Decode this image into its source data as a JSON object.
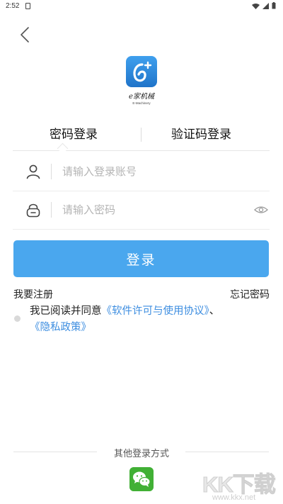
{
  "status_bar": {
    "time": "2:52"
  },
  "app": {
    "logo_text": "e家机械",
    "logo_subtext": "E-Machinery"
  },
  "tabs": [
    {
      "label": "密码登录",
      "active": true
    },
    {
      "label": "验证码登录",
      "active": false
    }
  ],
  "form": {
    "account": {
      "placeholder": "请输入登录账号",
      "value": ""
    },
    "password": {
      "placeholder": "请输入密码",
      "value": ""
    }
  },
  "login_button": "登录",
  "links": {
    "register": "我要注册",
    "forgot": "忘记密码"
  },
  "agreement": {
    "prefix": "我已阅读并同意",
    "software_link": "《软件许可与使用协议》",
    "separator": "、",
    "privacy_link": "《隐私政策》",
    "checked": false
  },
  "other_login": {
    "title": "其他登录方式",
    "wechat_icon": "wechat-icon"
  },
  "watermark": {
    "main": "KK下载",
    "sub": "www.kkx.net"
  },
  "colors": {
    "primary": "#4aa7ee",
    "link": "#3c8de0",
    "wechat": "#41b035"
  }
}
